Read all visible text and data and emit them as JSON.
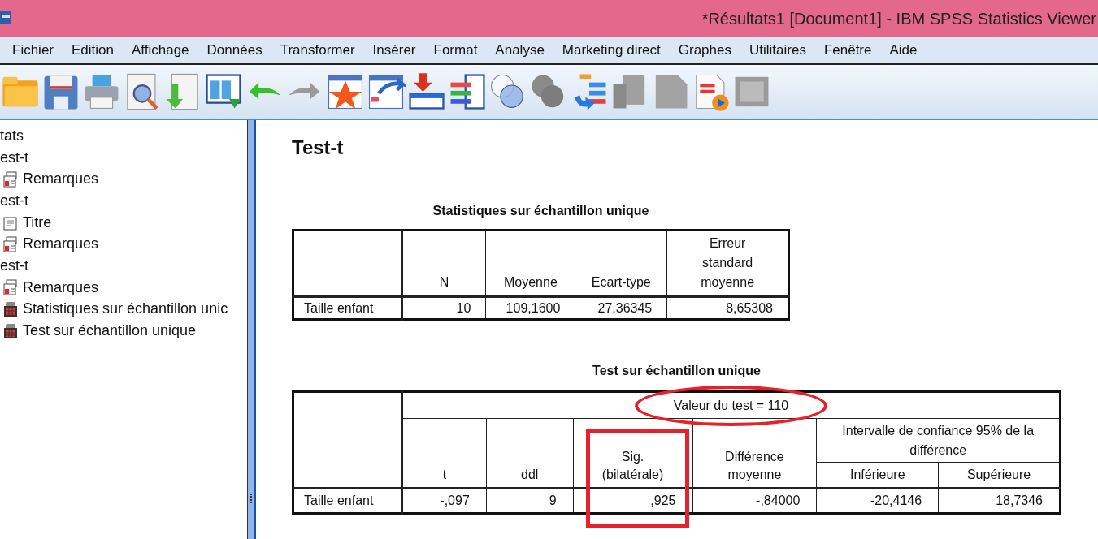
{
  "window": {
    "title": "*Résultats1 [Document1] - IBM SPSS Statistics Viewer"
  },
  "menu": [
    "Fichier",
    "Edition",
    "Affichage",
    "Données",
    "Transformer",
    "Insérer",
    "Format",
    "Analyse",
    "Marketing direct",
    "Graphes",
    "Utilitaires",
    "Fenêtre",
    "Aide"
  ],
  "outline": [
    {
      "label": "tats",
      "kind": "heading"
    },
    {
      "label": "est-t",
      "kind": "heading"
    },
    {
      "label": "Remarques",
      "kind": "note"
    },
    {
      "label": "est-t",
      "kind": "heading"
    },
    {
      "label": "Titre",
      "kind": "title"
    },
    {
      "label": "Remarques",
      "kind": "note"
    },
    {
      "label": "est-t",
      "kind": "heading"
    },
    {
      "label": "Remarques",
      "kind": "note"
    },
    {
      "label": "Statistiques sur échantillon unic",
      "kind": "table"
    },
    {
      "label": "Test sur échantillon unique",
      "kind": "table"
    }
  ],
  "heading": "Test-t",
  "stats_table": {
    "title": "Statistiques sur échantillon unique",
    "columns": [
      "N",
      "Moyenne",
      "Ecart-type",
      "Erreur standard moyenne"
    ],
    "rows": [
      {
        "label": "Taille enfant",
        "cells": [
          "10",
          "109,1600",
          "27,36345",
          "8,65308"
        ]
      }
    ]
  },
  "test_table": {
    "title": "Test sur échantillon unique",
    "test_value": {
      "text": "Valeur du test = 110",
      "circled": true
    },
    "columns": [
      {
        "text": "t",
        "boxed": false
      },
      {
        "text": "ddl",
        "boxed": false
      },
      {
        "text": "Sig. (bilatérale)",
        "boxed": true
      },
      {
        "text": "Différence moyenne",
        "boxed": false
      }
    ],
    "interval": {
      "text": "Intervalle de confiance 95% de la différence",
      "columns": [
        "Inférieure",
        "Supérieure"
      ]
    },
    "rows": [
      {
        "label": "Taille enfant",
        "cells": [
          "-,097",
          "9",
          ",925",
          "-,84000",
          "-20,4146",
          "18,7346"
        ]
      }
    ]
  }
}
